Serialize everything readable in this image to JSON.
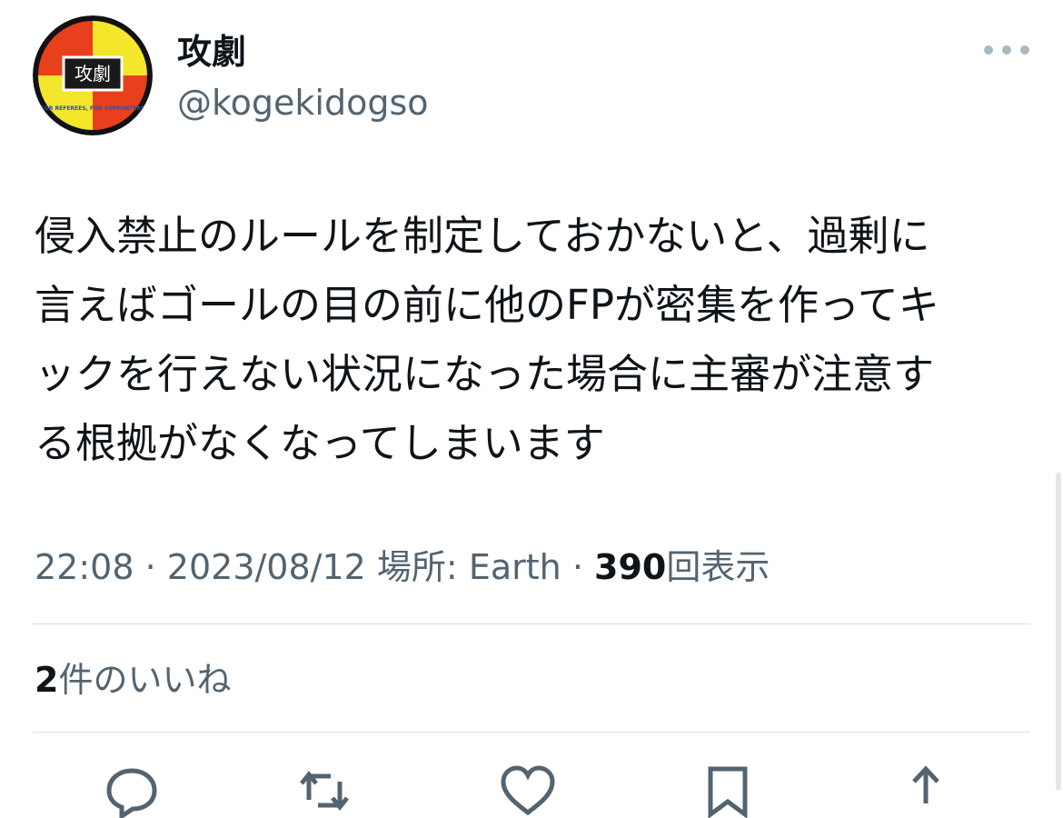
{
  "user": {
    "display_name": "攻劇",
    "handle": "@kogekidogso",
    "avatar_text": "攻劇",
    "avatar_subtext": "FOR REFEREES, FOR SUPPORTERS"
  },
  "tweet": {
    "text": "侵入禁止のルールを制定しておかないと、過剰に\n言えばゴールの目の前に他のFPが密集を作ってキ\nックを行えない状況になった場合に主審が注意す\nる根拠がなくなってしまいます"
  },
  "meta": {
    "time": "22:08",
    "separator": "·",
    "date": "2023/08/12",
    "location_label": "場所:",
    "location": "Earth",
    "views_count": "390",
    "views_label": "回表示"
  },
  "likes": {
    "count": "2",
    "label": "件のいいね"
  },
  "colors": {
    "text_primary": "#0f1419",
    "text_secondary": "#536471",
    "divider": "#d8dee2",
    "avatar_red": "#e8401c",
    "avatar_yellow": "#f4e62a"
  },
  "icons": [
    "more-icon",
    "reply-icon",
    "retweet-icon",
    "like-icon",
    "bookmark-icon",
    "share-icon"
  ]
}
